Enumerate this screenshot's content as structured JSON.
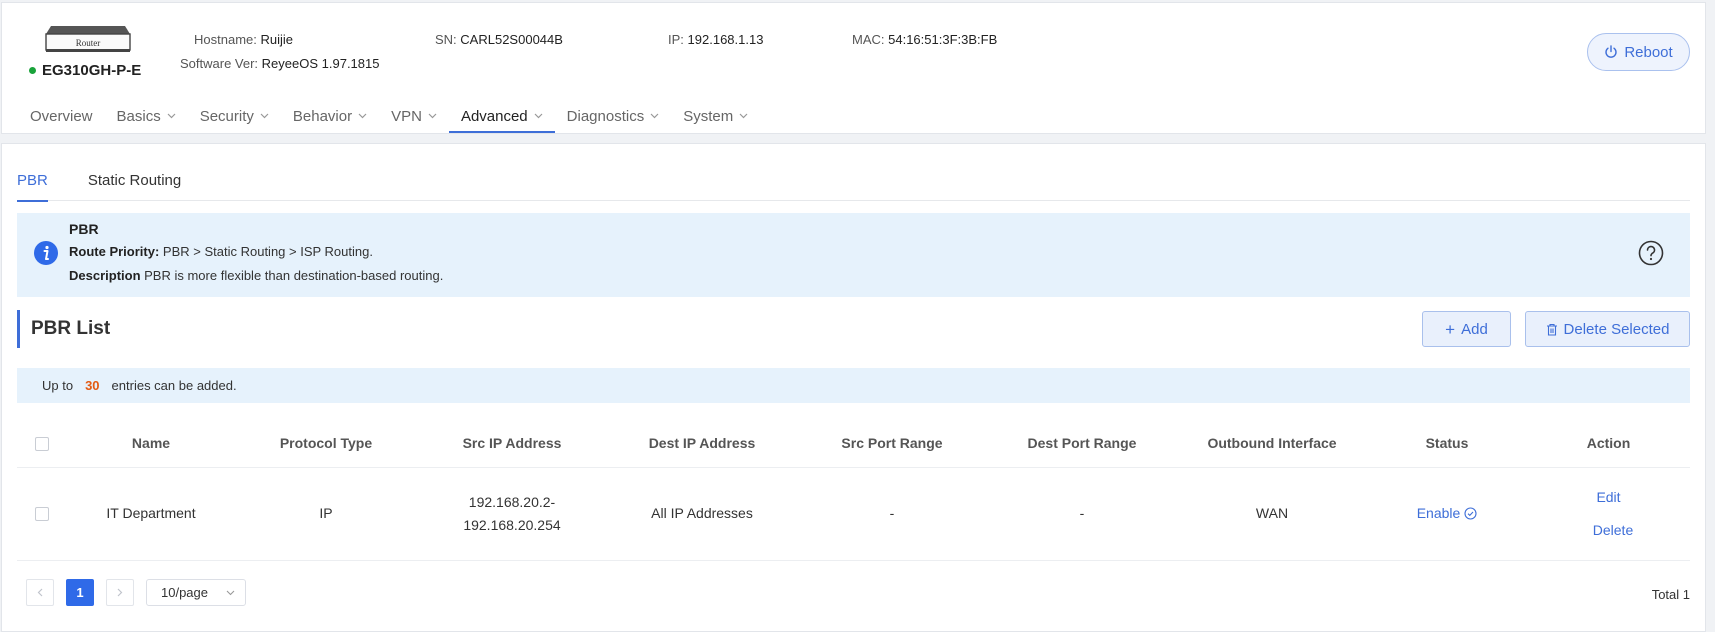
{
  "device": {
    "icon_label": "Router",
    "model": "EG310GH-P-E",
    "status_color": "#19a33a",
    "hostname_label": "Hostname:",
    "hostname": "Ruijie",
    "software_label": "Software Ver:",
    "software": "ReyeeOS 1.97.1815",
    "sn_label": "SN:",
    "sn": "CARL52S00044B",
    "ip_label": "IP:",
    "ip": "192.168.1.13",
    "mac_label": "MAC:",
    "mac": "54:16:51:3F:3B:FB"
  },
  "reboot_label": "Reboot",
  "nav": [
    {
      "label": "Overview",
      "dropdown": false,
      "active": false
    },
    {
      "label": "Basics",
      "dropdown": true,
      "active": false
    },
    {
      "label": "Security",
      "dropdown": true,
      "active": false
    },
    {
      "label": "Behavior",
      "dropdown": true,
      "active": false
    },
    {
      "label": "VPN",
      "dropdown": true,
      "active": false
    },
    {
      "label": "Advanced",
      "dropdown": true,
      "active": true
    },
    {
      "label": "Diagnostics",
      "dropdown": true,
      "active": false
    },
    {
      "label": "System",
      "dropdown": true,
      "active": false
    }
  ],
  "subtabs": [
    {
      "label": "PBR",
      "active": true
    },
    {
      "label": "Static Routing",
      "active": false
    }
  ],
  "notice": {
    "title": "PBR",
    "priority_label": "Route Priority:",
    "priority_text": "PBR > Static Routing > ISP Routing.",
    "description_label": "Description",
    "description_text": "PBR is more flexible than destination-based routing."
  },
  "list": {
    "title": "PBR List",
    "add_label": "Add",
    "delete_selected_label": "Delete Selected",
    "limit_prefix": "Up to",
    "limit_count": "30",
    "limit_suffix": "entries can be added."
  },
  "table": {
    "columns": [
      "Name",
      "Protocol Type",
      "Src IP Address",
      "Dest IP Address",
      "Src Port Range",
      "Dest Port Range",
      "Outbound Interface",
      "Status",
      "Action"
    ],
    "rows": [
      {
        "name": "IT Department",
        "protocol": "IP",
        "src_ip_line1": "192.168.20.2-",
        "src_ip_line2": "192.168.20.254",
        "dest_ip": "All IP Addresses",
        "src_port": "-",
        "dest_port": "-",
        "interface": "WAN",
        "status": "Enable",
        "edit_label": "Edit",
        "delete_label": "Delete"
      }
    ]
  },
  "pagination": {
    "current_page": "1",
    "page_size": "10/page",
    "total": "Total 1"
  },
  "colors": {
    "accent": "#3e6ed8",
    "limit_number": "#e35a12",
    "notice_bg": "#e6f2fc"
  }
}
